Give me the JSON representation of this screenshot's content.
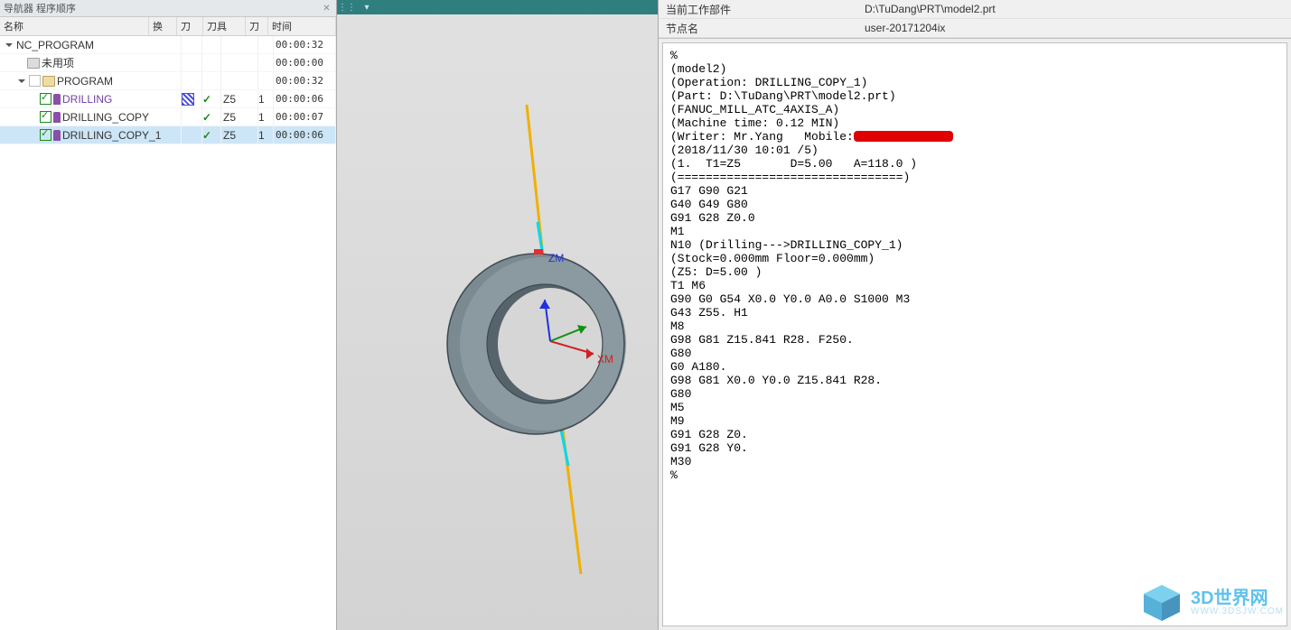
{
  "leftPanel": {
    "title": "导航器  程序顺序",
    "headers": {
      "name": "名称",
      "huan": "换",
      "dao": "刀",
      "tool": "刀具",
      "daon": "刀",
      "time": "时间"
    },
    "rows": [
      {
        "indent": 0,
        "tri": "open",
        "icon": "none",
        "chk": "none",
        "label": "NC_PROGRAM",
        "color": "",
        "huan": "",
        "dao": "",
        "tool": "",
        "daon": "",
        "time": "00:00:32",
        "sel": false
      },
      {
        "indent": 1,
        "tri": "none",
        "icon": "folder-grey",
        "chk": "none",
        "label": "未用项",
        "color": "",
        "huan": "",
        "dao": "",
        "tool": "",
        "daon": "",
        "time": "00:00:00",
        "sel": false
      },
      {
        "indent": 1,
        "tri": "open",
        "icon": "folder",
        "chk": "ghost",
        "label": "PROGRAM",
        "color": "",
        "huan": "",
        "dao": "",
        "tool": "",
        "daon": "",
        "time": "00:00:32",
        "sel": false
      },
      {
        "indent": 2,
        "tri": "none",
        "icon": "op",
        "chk": "chk",
        "label": "DRILLING",
        "color": "violet",
        "huan": "hatch",
        "dao": "tick",
        "tool": "Z5",
        "daon": "1",
        "time": "00:00:06",
        "sel": false
      },
      {
        "indent": 2,
        "tri": "none",
        "icon": "op",
        "chk": "chk",
        "label": "DRILLING_COPY",
        "color": "",
        "huan": "",
        "dao": "tick",
        "tool": "Z5",
        "daon": "1",
        "time": "00:00:07",
        "sel": false
      },
      {
        "indent": 2,
        "tri": "none",
        "icon": "op",
        "chk": "chk",
        "label": "DRILLING_COPY_1",
        "color": "",
        "huan": "",
        "dao": "tick",
        "tool": "Z5",
        "daon": "1",
        "time": "00:00:06",
        "sel": true
      }
    ]
  },
  "viewport": {
    "axis": {
      "xm": "XM",
      "zm": "ZM"
    }
  },
  "info": {
    "rows": [
      {
        "label": "当前工作部件",
        "value": "D:\\TuDang\\PRT\\model2.prt"
      },
      {
        "label": "节点名",
        "value": "user-20171204ix"
      }
    ]
  },
  "gcode": {
    "prefix": "%\n(model2)\n(Operation: DRILLING_COPY_1)\n(Part: D:\\TuDang\\PRT\\model2.prt)\n(FANUC_MILL_ATC_4AXIS_A)\n(Machine time: 0.12 MIN)\n(Writer: Mr.Yang   Mobile:",
    "suffix": "\n(2018/11/30 10:01 /5)\n(1.  T1=Z5       D=5.00   A=118.0 )\n(================================)\nG17 G90 G21\nG40 G49 G80\nG91 G28 Z0.0\nM1\nN10 (Drilling--->DRILLING_COPY_1)\n(Stock=0.000mm Floor=0.000mm)\n(Z5: D=5.00 )\nT1 M6\nG90 G0 G54 X0.0 Y0.0 A0.0 S1000 M3\nG43 Z55. H1\nM8\nG98 G81 Z15.841 R28. F250.\nG80\nG0 A180.\nG98 G81 X0.0 Y0.0 Z15.841 R28.\nG80\nM5\nM9\nG91 G28 Z0.\nG91 G28 Y0.\nM30\n%"
  },
  "watermark": {
    "title": "3D世界网",
    "sub": "WWW.3DSJW.COM"
  }
}
